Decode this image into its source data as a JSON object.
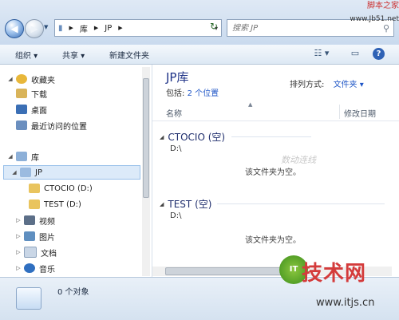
{
  "addressbar": {
    "back_glyph": "◀",
    "forward_glyph": "▶",
    "history_glyph": "▼",
    "path": [
      "库",
      "JP"
    ],
    "path_separator": "▶",
    "refresh_glyph": "↻",
    "search_placeholder": "搜索 JP",
    "search_glyph": "⚲"
  },
  "watermark_top": {
    "line1": "脚本之家",
    "line2": "www.Jb51.net"
  },
  "toolbar": {
    "organize": "组织 ▾",
    "share": "共享 ▾",
    "new_folder": "新建文件夹",
    "view_glyph": "☷ ▾",
    "pane_glyph": "▭",
    "help_glyph": "?"
  },
  "sidebar": {
    "items": [
      {
        "label": "收藏夹",
        "arrow": "◢",
        "icon": "star-icon",
        "color": "#e8b73a"
      },
      {
        "label": "下载",
        "arrow": "",
        "icon": "download-folder-icon",
        "color": "#d9b45a"
      },
      {
        "label": "桌面",
        "arrow": "",
        "icon": "desktop-icon",
        "color": "#3b6fb5"
      },
      {
        "label": "最近访问的位置",
        "arrow": "",
        "icon": "recent-places-icon",
        "color": "#6b8fbf"
      },
      {
        "label": "库",
        "arrow": "◢",
        "icon": "library-icon",
        "color": "#8db0d8"
      },
      {
        "label": "JP",
        "arrow": "◢",
        "icon": "library-icon",
        "color": "#9bbbe0"
      },
      {
        "label": "CTOCIO (D:)",
        "arrow": "",
        "icon": "folder-icon",
        "color": "#e9c45e"
      },
      {
        "label": "TEST (D:)",
        "arrow": "",
        "icon": "folder-icon",
        "color": "#e9c45e"
      },
      {
        "label": "视频",
        "arrow": "▷",
        "icon": "videos-icon",
        "color": "#5c6f88"
      },
      {
        "label": "图片",
        "arrow": "▷",
        "icon": "pictures-icon",
        "color": "#5f8fc0"
      },
      {
        "label": "文档",
        "arrow": "▷",
        "icon": "documents-icon",
        "color": "#c9d6e6"
      },
      {
        "label": "音乐",
        "arrow": "▷",
        "icon": "music-icon",
        "color": "#2f6fc0"
      }
    ]
  },
  "main": {
    "title": "JP库",
    "includes_label": "包括:",
    "includes_link": "2 个位置",
    "arrange_label": "排列方式:",
    "arrange_value": "文件夹 ▾",
    "col_name": "名称",
    "col_date": "修改日期",
    "sort_glyph": "▲",
    "groups": [
      {
        "title": "CTOCIO (空)",
        "path": "D:\\",
        "empty_text": "该文件夹为空。"
      },
      {
        "title": "TEST (空)",
        "path": "D:\\",
        "empty_text": "该文件夹为空。"
      }
    ],
    "group_glyph": "◢"
  },
  "watermark_mid": "数动连线",
  "status": {
    "text": "0 个对象"
  },
  "watermark_bottom": {
    "badge": "IT",
    "big": "技术网",
    "site": "www.itjs.cn"
  }
}
